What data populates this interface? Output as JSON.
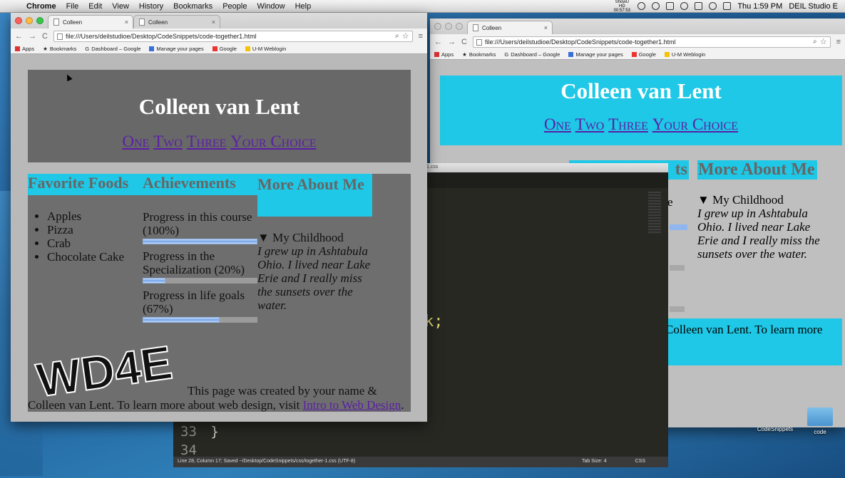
{
  "menubar": {
    "app": "Chrome",
    "items": [
      "File",
      "Edit",
      "View",
      "History",
      "Bookmarks",
      "People",
      "Window",
      "Help"
    ],
    "status_small": "ShowU HD 00:57:53",
    "clock": "Thu 1:59 PM",
    "user": "DEIL Studio E"
  },
  "browser": {
    "tabs": [
      "Colleen",
      "Colleen"
    ],
    "url": "file:///Users/deilstudioe/Desktop/CodeSnippets/code-together1.html",
    "bookmarks": [
      "Apps",
      "Bookmarks",
      "Dashboard – Google",
      "Manage your pages",
      "Google",
      "U-M Weblogin"
    ]
  },
  "page": {
    "title": "Colleen van Lent",
    "nav": [
      "One",
      "Two",
      "Three",
      "Your Choice"
    ],
    "col1": {
      "heading": "Favorite Foods",
      "items": [
        "Apples",
        "Pizza",
        "Crab",
        "Chocolate Cake"
      ]
    },
    "col2": {
      "heading": "Achievements",
      "progress": [
        {
          "label": "Progress in this course (100%)",
          "value": 1.0
        },
        {
          "label": "Progress in the Specialization (20%)",
          "value": 0.2
        },
        {
          "label": "Progress in life goals (67%)",
          "value": 0.67
        }
      ]
    },
    "col3": {
      "heading": "More About Me",
      "summary": "▼ My Childhood",
      "text": "I grew up in Ashtabula Ohio. I lived near Lake Erie and I really miss the sunsets over the water."
    },
    "footer": {
      "logo": "WD4E",
      "text": "This page was created by your name & Colleen van Lent. To learn more about web design, visit ",
      "link": "Intro to Web Design",
      "end": "."
    }
  },
  "back_page": {
    "col2_partial": "ts",
    "col1_partial": "e",
    "footer_partial": "Colleen van Lent. To learn more"
  },
  "editor": {
    "title": "1.css",
    "code_fragment": "k;",
    "line33_num": "33",
    "line33_code": "}",
    "line34_num": "34",
    "status_left": "Line 28, Column 17; Saved ~/Desktop/CodeSnippets/css/together-1.css (UTF-8)",
    "tab_size": "Tab Size: 4",
    "syntax": "CSS"
  },
  "desktop": {
    "folders": [
      "CodeSnippets",
      "code"
    ]
  },
  "colors": {
    "cyan": "#1fc8e6",
    "header_gray": "#686868",
    "link_purple": "#5a1fa5"
  }
}
